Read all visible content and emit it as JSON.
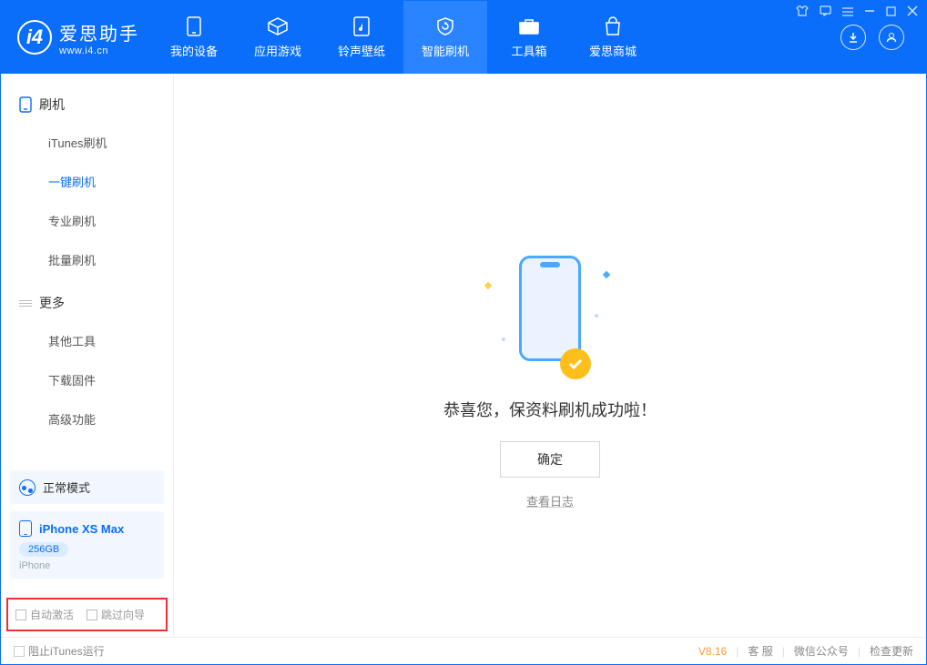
{
  "brand": {
    "name": "爱思助手",
    "url": "www.i4.cn"
  },
  "tabs": {
    "device": "我的设备",
    "apps": "应用游戏",
    "ring": "铃声壁纸",
    "flash": "智能刷机",
    "tools": "工具箱",
    "store": "爱思商城"
  },
  "sidebar": {
    "group_flash": "刷机",
    "items_flash": {
      "itunes": "iTunes刷机",
      "onekey": "一键刷机",
      "pro": "专业刷机",
      "batch": "批量刷机"
    },
    "group_more": "更多",
    "items_more": {
      "other": "其他工具",
      "firmware": "下载固件",
      "advanced": "高级功能"
    }
  },
  "device": {
    "mode": "正常模式",
    "name": "iPhone XS Max",
    "storage": "256GB",
    "type": "iPhone"
  },
  "options": {
    "auto_activate": "自动激活",
    "skip_wizard": "跳过向导"
  },
  "main": {
    "success": "恭喜您，保资料刷机成功啦！",
    "ok": "确定",
    "view_log": "查看日志"
  },
  "footer": {
    "block_itunes": "阻止iTunes运行",
    "version": "V8.16",
    "service": "客 服",
    "wechat": "微信公众号",
    "update": "检查更新"
  }
}
